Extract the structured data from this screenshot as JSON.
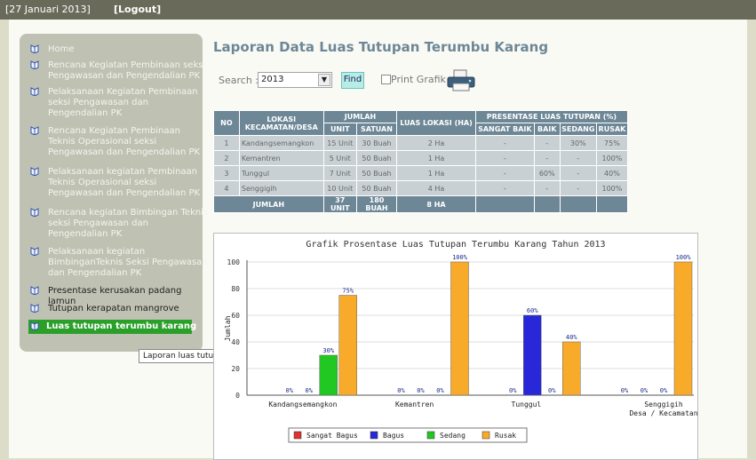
{
  "header": {
    "date": "[27 Januari 2013]",
    "logout": "[Logout]"
  },
  "sidebar": {
    "items": [
      {
        "label": "Home"
      },
      {
        "label": "Rencana Kegiatan Pembinaan seksi Pengawasan dan Pengendalian PK"
      },
      {
        "label": "Pelaksanaan Kegiatan Pembinaan seksi Pengawasan dan Pengendalian PK"
      },
      {
        "label": "Rencana Kegiatan Pembinaan Teknis Operasional seksi Pengawasan dan Pengendalian PK"
      },
      {
        "label": "Pelaksanaan kegiatan Pembinaan Teknis Operasional seksi Pengawasan dan Pengendalian PK"
      },
      {
        "label": "Rencana kegiatan Bimbingan Teknis seksi Pengawasan dan Pengendalian PK"
      },
      {
        "label": "Pelaksanaan kegiatan BimbinganTeknis Seksi Pengawasan dan Pengendalian PK"
      },
      {
        "label": "Presentase kerusakan padang lamun"
      },
      {
        "label": "Tutupan kerapatan mangrove"
      },
      {
        "label": "Luas tutupan terumbu karang"
      }
    ],
    "tooltip": "Laporan luas tutupan terumbu karang"
  },
  "main": {
    "title": "Laporan Data Luas Tutupan Terumbu Karang",
    "search_label": "Search :",
    "year": "2013",
    "find": "Find",
    "print_label": "Print Grafik"
  },
  "table": {
    "h_no": "NO",
    "h_lokasi": "LOKASI KECAMATAN/DESA",
    "h_jumlah": "JUMLAH",
    "h_unit": "UNIT",
    "h_satuan": "SATUAN",
    "h_luas": "LUAS LOKASI (HA)",
    "h_presentase": "PRESENTASE LUAS TUTUPAN (%)",
    "h_sangat": "SANGAT BAIK",
    "h_baik": "BAIK",
    "h_sedang": "SEDANG",
    "h_rusak": "RUSAK",
    "rows": [
      [
        "1",
        "Kandangsemangkon",
        "15 Unit",
        "30 Buah",
        "2 Ha",
        "-",
        "-",
        "30%",
        "75%"
      ],
      [
        "2",
        "Kemantren",
        "5 Unit",
        "50 Buah",
        "1 Ha",
        "-",
        "-",
        "-",
        "100%"
      ],
      [
        "3",
        "Tunggul",
        "7 Unit",
        "50 Buah",
        "1 Ha",
        "-",
        "60%",
        "-",
        "40%"
      ],
      [
        "4",
        "Senggigih",
        "10 Unit",
        "50 Buah",
        "4 Ha",
        "-",
        "-",
        "-",
        "100%"
      ]
    ],
    "total": {
      "label": "JUMLAH",
      "unit": "37 UNIT",
      "satuan": "180 BUAH",
      "luas": "8 HA"
    }
  },
  "chart_data": {
    "type": "bar",
    "title": "Grafik Prosentase Luas Tutupan Terumbu Karang Tahun 2013",
    "ylabel": "Jumlah",
    "xlabel": "Desa / Kecamatan",
    "ylim": [
      0,
      100
    ],
    "yticks": [
      0,
      20,
      40,
      60,
      80,
      100
    ],
    "categories": [
      "Kandangsemangkon",
      "Kemantren",
      "Tunggul",
      "Senggigih"
    ],
    "series": [
      {
        "name": "Sangat Bagus",
        "color": "#e03030",
        "values": [
          0,
          0,
          0,
          0
        ]
      },
      {
        "name": "Bagus",
        "color": "#2828d8",
        "values": [
          0,
          0,
          60,
          0
        ]
      },
      {
        "name": "Sedang",
        "color": "#22c822",
        "values": [
          30,
          0,
          0,
          0
        ]
      },
      {
        "name": "Rusak",
        "color": "#f8aa2a",
        "values": [
          75,
          100,
          40,
          100
        ]
      }
    ],
    "legend_position": "bottom"
  }
}
